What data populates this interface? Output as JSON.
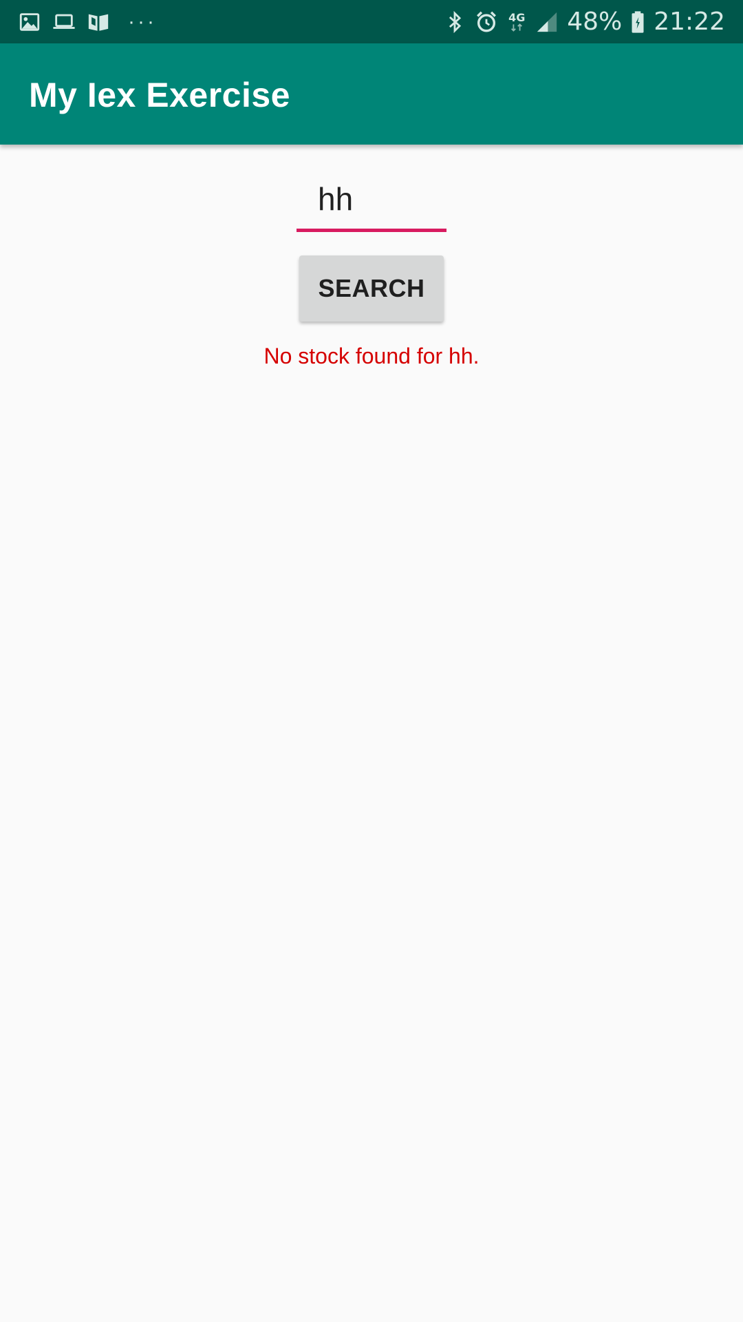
{
  "status_bar": {
    "left_icons": [
      "gallery-icon",
      "laptop-icon",
      "book-icon"
    ],
    "more_indicator": "···",
    "right_icons": [
      "bluetooth-icon",
      "alarm-icon",
      "network-4g-icon",
      "signal-icon",
      "battery-icon"
    ],
    "network_label": "4G",
    "battery_percent": "48%",
    "time": "21:22"
  },
  "app_bar": {
    "title": "My Iex Exercise",
    "color": "#008577",
    "status_color": "#00574b"
  },
  "search": {
    "input_value": "hh",
    "underline_color": "#d81b60",
    "button_label": "SEARCH"
  },
  "result": {
    "message": "No stock found for hh.",
    "color": "#d50000"
  }
}
